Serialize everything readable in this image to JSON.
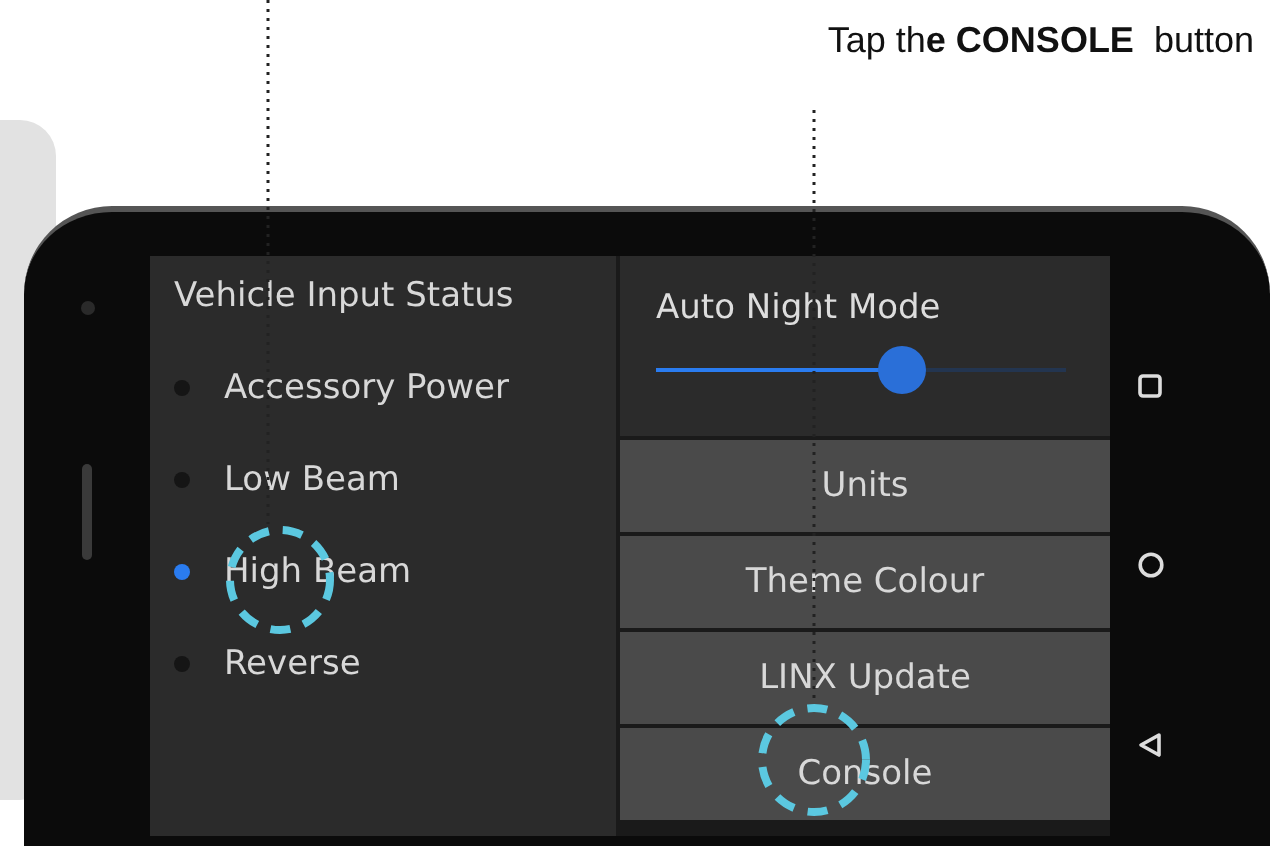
{
  "caption": "Tap th**e CONSOLE**  button",
  "status_panel": {
    "title": "Vehicle Input Status",
    "inputs": [
      {
        "label": "Accessory Power",
        "on": false
      },
      {
        "label": "Low Beam",
        "on": false
      },
      {
        "label": "High Beam",
        "on": true
      },
      {
        "label": "Reverse",
        "on": false
      }
    ]
  },
  "night_mode": {
    "label": "Auto Night Mode",
    "level": 0.6
  },
  "buttons": [
    "Units",
    "Theme Colour",
    "LINX Update",
    "Console"
  ]
}
